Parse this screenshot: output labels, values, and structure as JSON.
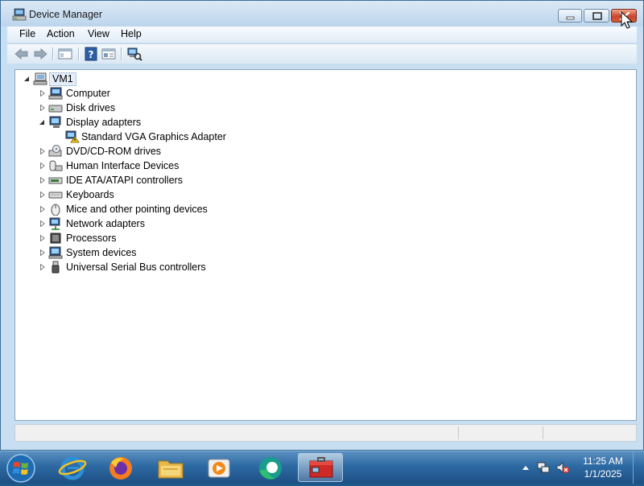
{
  "window": {
    "title": "Device Manager",
    "icon": "device-manager-icon"
  },
  "menu": {
    "items": [
      "File",
      "Action",
      "View",
      "Help"
    ]
  },
  "toolbar": {
    "buttons": [
      "back-arrow-icon",
      "forward-arrow-icon",
      "show-hide-console-tree-icon",
      "help-icon",
      "properties-icon",
      "scan-hardware-changes-icon"
    ]
  },
  "tree": {
    "root": {
      "label": "VM1",
      "icon": "computer-icon",
      "expanded": true
    },
    "nodes": [
      {
        "label": "Computer",
        "icon": "computer-icon",
        "expanded": false
      },
      {
        "label": "Disk drives",
        "icon": "disk-drive-icon",
        "expanded": false
      },
      {
        "label": "Display adapters",
        "icon": "display-adapter-icon",
        "expanded": true
      },
      {
        "label": "Standard VGA Graphics Adapter",
        "icon": "display-adapter-warning-icon",
        "child": true
      },
      {
        "label": "DVD/CD-ROM drives",
        "icon": "dvd-drive-icon",
        "expanded": false
      },
      {
        "label": "Human Interface Devices",
        "icon": "hid-icon",
        "expanded": false
      },
      {
        "label": "IDE ATA/ATAPI controllers",
        "icon": "ide-controller-icon",
        "expanded": false
      },
      {
        "label": "Keyboards",
        "icon": "keyboard-icon",
        "expanded": false
      },
      {
        "label": "Mice and other pointing devices",
        "icon": "mouse-icon",
        "expanded": false
      },
      {
        "label": "Network adapters",
        "icon": "network-adapter-icon",
        "expanded": false
      },
      {
        "label": "Processors",
        "icon": "processor-icon",
        "expanded": false
      },
      {
        "label": "System devices",
        "icon": "system-devices-icon",
        "expanded": false
      },
      {
        "label": "Universal Serial Bus controllers",
        "icon": "usb-icon",
        "expanded": false
      }
    ]
  },
  "taskbar": {
    "apps": [
      "internet-explorer-icon",
      "firefox-icon",
      "file-explorer-icon",
      "media-player-icon",
      "edge-icon",
      "device-manager-icon"
    ],
    "tray_icons": [
      "show-hidden-icons-icon",
      "network-icon",
      "volume-muted-icon"
    ],
    "clock": {
      "time": "11:25 AM",
      "date": "1/1/2025"
    }
  },
  "colors": {
    "close_button": "#c9452a",
    "taskbar": "#2d6aa3",
    "window_frame": "#c7dff1"
  }
}
